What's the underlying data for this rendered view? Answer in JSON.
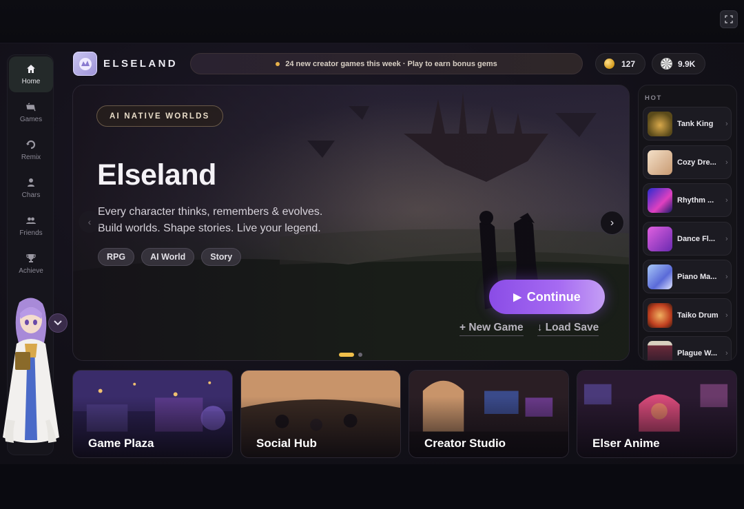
{
  "app": {
    "brand": "ELSELAND"
  },
  "ticker": {
    "text": "24 new creator games this week · Play to earn bonus gems"
  },
  "currency": {
    "coins": "127",
    "gems": "9.9K"
  },
  "sidebar": {
    "items": [
      {
        "label": "Home",
        "icon": "home-icon",
        "active": true
      },
      {
        "label": "Games",
        "icon": "gamepad-icon",
        "active": false
      },
      {
        "label": "Remix",
        "icon": "remix-icon",
        "active": false
      },
      {
        "label": "Chars",
        "icon": "person-icon",
        "active": false
      },
      {
        "label": "Friends",
        "icon": "friends-icon",
        "active": false
      },
      {
        "label": "Achieve",
        "icon": "trophy-icon",
        "active": false
      }
    ]
  },
  "hero": {
    "badge": "AI NATIVE WORLDS",
    "title": "Elseland",
    "subtitle_line1": "Every character thinks, remembers & evolves.",
    "subtitle_line2": "Build worlds. Shape stories. Live your legend.",
    "tags": [
      "RPG",
      "AI World",
      "Story"
    ],
    "continue_label": "Continue",
    "new_game_label": "+ New Game",
    "load_save_label": "↓ Load Save",
    "slide_count": 2,
    "active_slide": 1
  },
  "hot": {
    "label": "HOT",
    "items": [
      {
        "name": "Tank King",
        "color": "#c08a2a"
      },
      {
        "name": "Cozy Dre...",
        "color": "#e8c8a8"
      },
      {
        "name": "Rhythm ...",
        "color": "#4a5ae0"
      },
      {
        "name": "Dance Fl...",
        "color": "#b050d8"
      },
      {
        "name": "Piano Ma...",
        "color": "#6a8ae8"
      },
      {
        "name": "Taiko Drum",
        "color": "#d86a2a"
      },
      {
        "name": "Plague W...",
        "color": "#5a2a3a"
      }
    ]
  },
  "cards": [
    {
      "title": "Game Plaza"
    },
    {
      "title": "Social Hub"
    },
    {
      "title": "Creator Studio"
    },
    {
      "title": "Elser Anime"
    }
  ],
  "colors": {
    "accent": "#9a5cec",
    "gold": "#f0c04a"
  }
}
